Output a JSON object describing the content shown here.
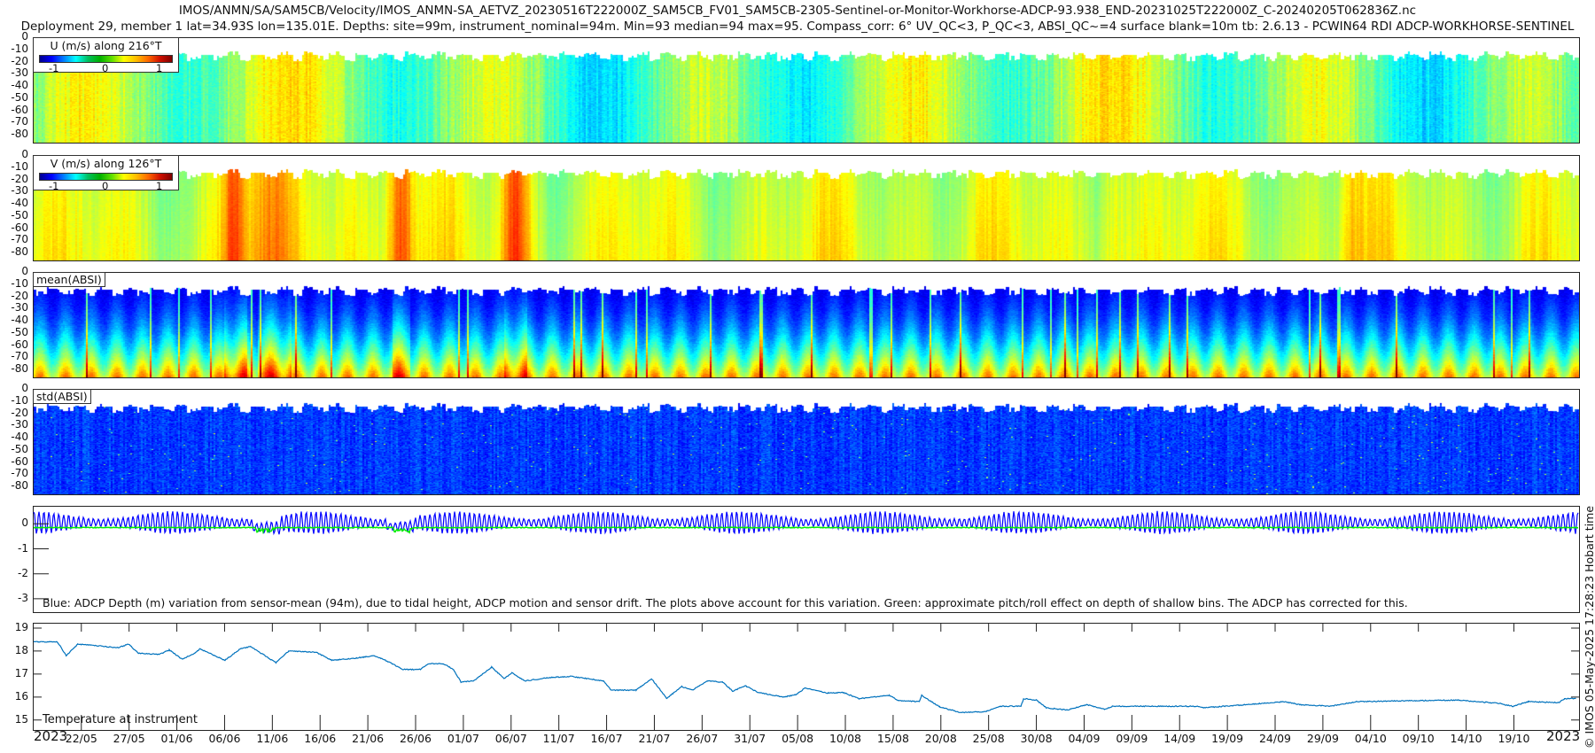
{
  "header": {
    "line1": "IMOS/ANMN/SA/SAM5CB/Velocity/IMOS_ANMN-SA_AETVZ_20230516T222000Z_SAM5CB_FV01_SAM5CB-2305-Sentinel-or-Monitor-Workhorse-ADCP-93.938_END-20231025T222000Z_C-20240205T062836Z.nc",
    "line2": "Deployment 29, member 1 lat=34.93S lon=135.01E. Depths: site=99m, instrument_nominal=94m. Min=93 median=94 max=95. Compass_corr: 6° UV_QC<3, P_QC<3, ABSI_QC~=4 surface blank=10m tb: 2.6.13 - PCWIN64 RDI ADCP-WORKHORSE-SENTINEL"
  },
  "copyright": "© IMOS 05-May-2025 17:28:23 Hobart time",
  "x_axis": {
    "range": [
      "2023-05-16T22",
      "2023-10-25T22"
    ],
    "year_left": "2023",
    "year_right": "2023",
    "tick_labels": [
      "22/05",
      "27/05",
      "01/06",
      "06/06",
      "11/06",
      "16/06",
      "21/06",
      "26/06",
      "01/07",
      "06/07",
      "11/07",
      "16/07",
      "21/07",
      "26/07",
      "31/07",
      "05/08",
      "10/08",
      "15/08",
      "20/08",
      "25/08",
      "30/08",
      "04/09",
      "09/09",
      "14/09",
      "19/09",
      "24/09",
      "29/09",
      "04/10",
      "09/10",
      "14/10",
      "19/10"
    ]
  },
  "chart_data": [
    {
      "type": "heatmap",
      "legend_title": "U (m/s) along 216°T",
      "colorbar_ticks": [
        "-1",
        "0",
        "1"
      ],
      "clim": [
        -1.3,
        1.3
      ],
      "colormap": "jet",
      "yticks": [
        "0",
        "-10",
        "-20",
        "-30",
        "-40",
        "-50",
        "-60",
        "-70",
        "-80"
      ],
      "ylim": [
        -87,
        0
      ]
    },
    {
      "type": "heatmap",
      "legend_title": "V (m/s) along 126°T",
      "colorbar_ticks": [
        "-1",
        "0",
        "1"
      ],
      "clim": [
        -1.3,
        1.3
      ],
      "colormap": "jet",
      "yticks": [
        "0",
        "-10",
        "-20",
        "-30",
        "-40",
        "-50",
        "-60",
        "-70",
        "-80"
      ],
      "ylim": [
        -87,
        0
      ]
    },
    {
      "type": "heatmap",
      "label": "mean(ABSI)",
      "colormap": "jet",
      "yticks": [
        "0",
        "-10",
        "-20",
        "-30",
        "-40",
        "-50",
        "-60",
        "-70",
        "-80"
      ],
      "ylim": [
        -87,
        0
      ]
    },
    {
      "type": "heatmap",
      "label": "std(ABSI)",
      "colormap": "jet",
      "yticks": [
        "0",
        "-10",
        "-20",
        "-30",
        "-40",
        "-50",
        "-60",
        "-70",
        "-80"
      ],
      "ylim": [
        -87,
        0
      ]
    },
    {
      "type": "line",
      "yticks": [
        "0",
        "-1",
        "-2",
        "-3"
      ],
      "ylim": [
        -0.72,
        3.57
      ],
      "y_reversed": true,
      "series_colors": {
        "depth": "#0000ff",
        "pitch_roll": "#00ee00"
      },
      "annotation": "Blue: ADCP Depth (m) variation from sensor-mean (94m), due to tidal height, ADCP motion and sensor drift. The plots above account for this variation. Green: approximate pitch/roll effect on depth of shallow bins. The ADCP has corrected for this."
    },
    {
      "type": "line",
      "label": "Temperature at instrument",
      "yticks": [
        "15",
        "16",
        "17",
        "18",
        "19"
      ],
      "ylim": [
        14.53,
        19.23
      ],
      "color": "#0072bd",
      "x": [
        "2023-05-17T00",
        "2023-05-19T12",
        "2023-05-20T10",
        "2023-05-21T15",
        "2023-05-25T21",
        "2023-05-26T23",
        "2023-05-28T00",
        "2023-05-30T04",
        "2023-05-31T05",
        "2023-06-01T13",
        "2023-06-02T21",
        "2023-06-03T10",
        "2023-06-06T01",
        "2023-06-07T16",
        "2023-06-08T17",
        "2023-06-11T09",
        "2023-06-12T17",
        "2023-06-15T14",
        "2023-06-17T05",
        "2023-06-19T21",
        "2023-06-21T17",
        "2023-06-23T02",
        "2023-06-24T16",
        "2023-06-26T12",
        "2023-06-27T07",
        "2023-06-28T22",
        "2023-06-29T23",
        "2023-06-30T18",
        "2023-07-02T02",
        "2023-07-03T23",
        "2023-07-05T07",
        "2023-07-06T02",
        "2023-07-07T10",
        "2023-07-10T02",
        "2023-07-12T05",
        "2023-07-15T16",
        "2023-07-16T11",
        "2023-07-19T02",
        "2023-07-20T17",
        "2023-07-22T07",
        "2023-07-23T21",
        "2023-07-24T23",
        "2023-07-26T13",
        "2023-07-28T04",
        "2023-07-29T05",
        "2023-07-30T12",
        "2023-07-31T21",
        "2023-08-03T12",
        "2023-08-04T20",
        "2023-08-05T19",
        "2023-08-08T05",
        "2023-08-09T19",
        "2023-08-11T10",
        "2023-08-14T14",
        "2023-08-15T15",
        "2023-08-17T18",
        "2023-08-18T00",
        "2023-08-19T21",
        "2023-08-22T00",
        "2023-08-24T16",
        "2023-08-26T06",
        "2023-08-28T09",
        "2023-08-28T16",
        "2023-08-30T00",
        "2023-08-31T01",
        "2023-09-02T05",
        "2023-09-04T07",
        "2023-09-06T04",
        "2023-09-06T23",
        "2023-09-15T23",
        "2023-09-16T12",
        "2023-09-25T00",
        "2023-09-26T14",
        "2023-09-29T19",
        "2023-10-02T12",
        "2023-10-13T02",
        "2023-10-17T08",
        "2023-10-18T22",
        "2023-10-20T12",
        "2023-10-23T17",
        "2023-10-24T07",
        "2023-10-25T14"
      ],
      "y": [
        18.4,
        18.4,
        17.8,
        18.3,
        18.15,
        18.3,
        17.9,
        17.85,
        18.05,
        17.65,
        17.9,
        18.1,
        17.6,
        18.1,
        18.2,
        17.5,
        18.0,
        17.95,
        17.6,
        17.7,
        17.8,
        17.55,
        17.2,
        17.2,
        17.45,
        17.45,
        17.2,
        16.65,
        16.7,
        17.3,
        16.8,
        17.05,
        16.7,
        16.85,
        16.9,
        16.7,
        16.3,
        16.3,
        16.8,
        15.95,
        16.45,
        16.3,
        16.7,
        16.65,
        16.25,
        16.5,
        16.2,
        16.0,
        16.1,
        16.4,
        16.17,
        16.2,
        15.93,
        16.07,
        15.84,
        15.8,
        16.07,
        15.57,
        15.33,
        15.36,
        15.6,
        15.6,
        15.93,
        15.87,
        15.53,
        15.44,
        15.67,
        15.47,
        15.6,
        15.6,
        15.53,
        15.8,
        15.67,
        15.6,
        15.8,
        15.87,
        15.73,
        15.6,
        15.8,
        15.76,
        15.93,
        15.93
      ]
    }
  ]
}
